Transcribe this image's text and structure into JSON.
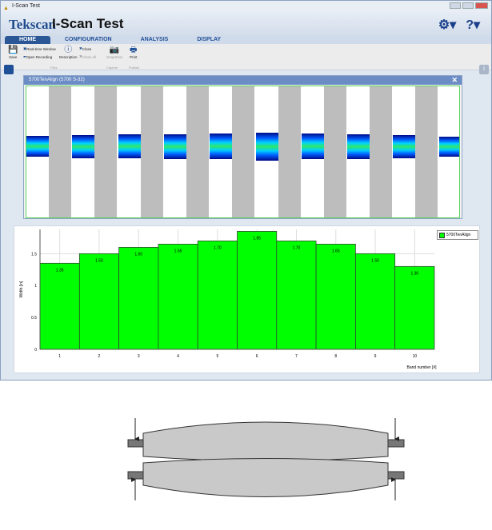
{
  "window": {
    "title": "I-Scan Test"
  },
  "header": {
    "logo": "Tekscan",
    "app_title": "I-Scan Test",
    "settings_icon": "gear-icon",
    "help_icon": "help-icon"
  },
  "tabs": [
    {
      "label": "HOME",
      "active": true
    },
    {
      "label": "CONFIGURATION"
    },
    {
      "label": "ANALYSIS"
    },
    {
      "label": "DISPLAY"
    }
  ],
  "ribbon": {
    "save": "Save",
    "realtime": "Real-time Window",
    "open_recording": "Open Recording",
    "description": "Description",
    "close": "Close",
    "close_all": "Close All",
    "snapshot": "SnapShot",
    "print": "Print",
    "group_files": "Files",
    "group_capture": "Capture",
    "group_publish": "Publish"
  },
  "panel": {
    "title": "5700TenAlign (5700 S-32)"
  },
  "chart_data": {
    "type": "bar",
    "categories": [
      "1",
      "2",
      "3",
      "4",
      "5",
      "6",
      "7",
      "8",
      "9",
      "10"
    ],
    "values": [
      1.35,
      1.5,
      1.6,
      1.65,
      1.7,
      1.85,
      1.7,
      1.65,
      1.5,
      1.3
    ],
    "labels": [
      "1.35",
      "1.50",
      "1.60",
      "1.65",
      "1.70",
      "1.85",
      "1.70",
      "1.65",
      "1.50",
      "1.30"
    ],
    "xlabel": "Band number [#]",
    "ylabel": "Width [in]",
    "ylim": [
      0,
      1.88
    ],
    "yticks": [
      "0",
      "0.5",
      "1",
      "1.5"
    ],
    "ytick_values": [
      0,
      0.5,
      1,
      1.5
    ],
    "legend": [
      "5700TenAlign"
    ],
    "legend_position": "top-right",
    "color": "#00ff00",
    "grid": true
  }
}
